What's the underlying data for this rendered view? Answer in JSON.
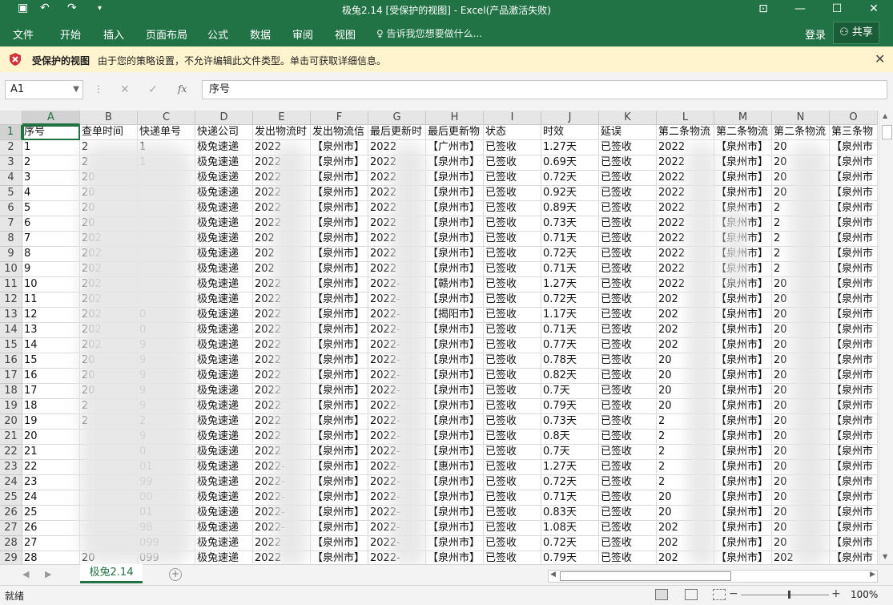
{
  "window": {
    "title": "极兔2.14  [受保护的视图] - Excel(产品激活失败)"
  },
  "quick_access": {
    "save_icon": "save-icon",
    "undo_icon": "undo-icon",
    "redo_icon": "redo-icon",
    "customize_icon": "chevron-down-icon"
  },
  "ribbon": {
    "tabs": [
      "文件",
      "开始",
      "插入",
      "页面布局",
      "公式",
      "数据",
      "审阅",
      "视图"
    ],
    "tell_me": "告诉我您想要做什么...",
    "login": "登录",
    "share": "共享"
  },
  "protected_bar": {
    "title": "受保护的视图",
    "message": "由于您的策略设置，不允许编辑此文件类型。单击可获取详细信息。"
  },
  "formula_bar": {
    "name_box": "A1",
    "formula": "序号",
    "fx": "fx"
  },
  "columns": [
    "A",
    "B",
    "C",
    "D",
    "E",
    "F",
    "G",
    "H",
    "I",
    "J",
    "K",
    "L",
    "M",
    "N",
    "O"
  ],
  "row_numbers": [
    "1",
    "2",
    "3",
    "4",
    "5",
    "6",
    "7",
    "8",
    "9",
    "10",
    "11",
    "12",
    "13",
    "14",
    "15",
    "16",
    "17",
    "18",
    "19",
    "20",
    "21",
    "22",
    "23",
    "24",
    "25",
    "26",
    "27",
    "28",
    "29"
  ],
  "headers": [
    "序号",
    "查单时间",
    "快递单号",
    "快递公司",
    "发出物流时",
    "发出物流信",
    "最后更新时",
    "最后更新物",
    "状态",
    "时效",
    "延误",
    "第二条物流",
    "第二条物流",
    "第二条物流",
    "第三条物"
  ],
  "rows": [
    [
      "1",
      "2",
      "1",
      "极兔速递",
      "2022",
      "【泉州市】",
      "2022",
      "【广州市】",
      "已签收",
      "1.27天",
      "已签收",
      "2022",
      "【泉州市】",
      "20",
      "【泉州市"
    ],
    [
      "2",
      "2",
      "1",
      "极兔速递",
      "2022",
      "【泉州市】",
      "2022",
      "【泉州市】",
      "已签收",
      "0.69天",
      "已签收",
      "2022",
      "【泉州市】",
      "20",
      "【泉州市"
    ],
    [
      "3",
      "20",
      "",
      "极兔速递",
      "2022",
      "【泉州市】",
      "2022",
      "【泉州市】",
      "已签收",
      "0.72天",
      "已签收",
      "2022",
      "【泉州市】",
      "20",
      "【泉州市"
    ],
    [
      "4",
      "20",
      "",
      "极兔速递",
      "2022",
      "【泉州市】",
      "2022",
      "【泉州市】",
      "已签收",
      "0.92天",
      "已签收",
      "2022",
      "【泉州市】",
      "20",
      "【泉州市"
    ],
    [
      "5",
      "20",
      "",
      "极兔速递",
      "2022",
      "【泉州市】",
      "2022",
      "【泉州市】",
      "已签收",
      "0.89天",
      "已签收",
      "2022",
      "【泉州市】",
      "2",
      "【泉州市"
    ],
    [
      "6",
      "20",
      "",
      "极兔速递",
      "2022",
      "【泉州市】",
      "2022",
      "【泉州市】",
      "已签收",
      "0.73天",
      "已签收",
      "2022",
      "【泉州市】",
      "2",
      "【泉州市"
    ],
    [
      "7",
      "202",
      "",
      "极兔速递",
      "202",
      "【泉州市】",
      "2022",
      "【泉州市】",
      "已签收",
      "0.71天",
      "已签收",
      "2022",
      "【泉州市】",
      "2",
      "【泉州市"
    ],
    [
      "8",
      "202",
      "",
      "极兔速递",
      "202",
      "【泉州市】",
      "2022",
      "【泉州市】",
      "已签收",
      "0.72天",
      "已签收",
      "2022",
      "【泉州市】",
      "2",
      "【泉州市"
    ],
    [
      "9",
      "202",
      "",
      "极兔速递",
      "202",
      "【泉州市】",
      "2022",
      "【泉州市】",
      "已签收",
      "0.71天",
      "已签收",
      "2022",
      "【泉州市】",
      "2",
      "【泉州市"
    ],
    [
      "10",
      "202",
      "",
      "极兔速递",
      "2022",
      "【泉州市】",
      "2022-",
      "【赣州市】",
      "已签收",
      "1.27天",
      "已签收",
      "2022",
      "【泉州市】",
      "20",
      "【泉州市"
    ],
    [
      "11",
      "202",
      "",
      "极兔速递",
      "2022",
      "【泉州市】",
      "2022-",
      "【泉州市】",
      "已签收",
      "0.72天",
      "已签收",
      "202",
      "【泉州市】",
      "20",
      "【泉州市"
    ],
    [
      "12",
      "202",
      "0",
      "极兔速递",
      "2022",
      "【泉州市】",
      "2022-",
      "【揭阳市】",
      "已签收",
      "1.17天",
      "已签收",
      "202",
      "【泉州市】",
      "20",
      "【泉州市"
    ],
    [
      "13",
      "202",
      "0",
      "极兔速递",
      "2022",
      "【泉州市】",
      "2022-",
      "【泉州市】",
      "已签收",
      "0.71天",
      "已签收",
      "202",
      "【泉州市】",
      "20",
      "【泉州市"
    ],
    [
      "14",
      "202",
      "9",
      "极兔速递",
      "2022",
      "【泉州市】",
      "2022-",
      "【泉州市】",
      "已签收",
      "0.77天",
      "已签收",
      "202",
      "【泉州市】",
      "20",
      "【泉州市"
    ],
    [
      "15",
      "20",
      "9",
      "极兔速递",
      "2022",
      "【泉州市】",
      "2022-",
      "【泉州市】",
      "已签收",
      "0.78天",
      "已签收",
      "20",
      "【泉州市】",
      "20",
      "【泉州市"
    ],
    [
      "16",
      "20",
      "9",
      "极兔速递",
      "2022",
      "【泉州市】",
      "2022-",
      "【泉州市】",
      "已签收",
      "0.82天",
      "已签收",
      "20",
      "【泉州市】",
      "20",
      "【泉州市"
    ],
    [
      "17",
      "20",
      "9",
      "极兔速递",
      "2022",
      "【泉州市】",
      "2022-",
      "【泉州市】",
      "已签收",
      "0.7天",
      "已签收",
      "20",
      "【泉州市】",
      "20",
      "【泉州市"
    ],
    [
      "18",
      "2",
      "9",
      "极兔速递",
      "2022",
      "【泉州市】",
      "2022-",
      "【泉州市】",
      "已签收",
      "0.79天",
      "已签收",
      "20",
      "【泉州市】",
      "20",
      "【泉州市"
    ],
    [
      "19",
      "2",
      "2",
      "极兔速递",
      "2022",
      "【泉州市】",
      "2022-",
      "【泉州市】",
      "已签收",
      "0.73天",
      "已签收",
      "2",
      "【泉州市】",
      "20",
      "【泉州市"
    ],
    [
      "20",
      "",
      "9",
      "极兔速递",
      "2022",
      "【泉州市】",
      "2022-",
      "【泉州市】",
      "已签收",
      "0.8天",
      "已签收",
      "2",
      "【泉州市】",
      "20",
      "【泉州市"
    ],
    [
      "21",
      "",
      "0",
      "极兔速递",
      "2022",
      "【泉州市】",
      "2022-",
      "【泉州市】",
      "已签收",
      "0.7天",
      "已签收",
      "2",
      "【泉州市】",
      "20",
      "【泉州市"
    ],
    [
      "22",
      "",
      "01",
      "极兔速递",
      "2022-",
      "【泉州市】",
      "2022-",
      "【惠州市】",
      "已签收",
      "1.27天",
      "已签收",
      "2",
      "【泉州市】",
      "20",
      "【泉州市"
    ],
    [
      "23",
      "",
      "99",
      "极兔速递",
      "2022-",
      "【泉州市】",
      "2022-",
      "【泉州市】",
      "已签收",
      "0.72天",
      "已签收",
      "2",
      "【泉州市】",
      "20",
      "【泉州市"
    ],
    [
      "24",
      "",
      "00",
      "极兔速递",
      "2022-",
      "【泉州市】",
      "2022-",
      "【泉州市】",
      "已签收",
      "0.71天",
      "已签收",
      "20",
      "【泉州市】",
      "20",
      "【泉州市"
    ],
    [
      "25",
      "",
      "01",
      "极兔速递",
      "2022-",
      "【泉州市】",
      "2022-",
      "【泉州市】",
      "已签收",
      "0.83天",
      "已签收",
      "20",
      "【泉州市】",
      "20",
      "【泉州市"
    ],
    [
      "26",
      "",
      "98",
      "极兔速递",
      "2022-",
      "【泉州市】",
      "2022-",
      "【泉州市】",
      "已签收",
      "1.08天",
      "已签收",
      "202",
      "【泉州市】",
      "20",
      "【泉州市"
    ],
    [
      "27",
      "",
      "099",
      "极兔速递",
      "2022",
      "【泉州市】",
      "2022-",
      "【泉州市】",
      "已签收",
      "0.72天",
      "已签收",
      "202",
      "【泉州市】",
      "20",
      "【泉州市"
    ],
    [
      "28",
      "20",
      "099",
      "极兔速递",
      "2022",
      "【泉州市】",
      "2022-",
      "【泉州市】",
      "已签收",
      "0.79天",
      "已签收",
      "202",
      "【泉州市】",
      "202",
      "【泉州市"
    ]
  ],
  "sheet_tab": "极兔2.14",
  "status": {
    "ready": "就绪",
    "zoom": "100%"
  }
}
